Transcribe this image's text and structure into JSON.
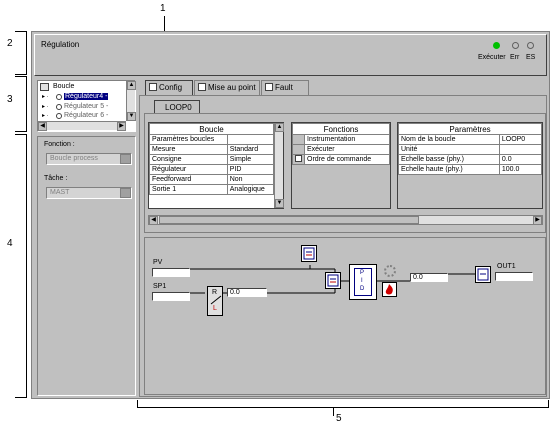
{
  "callouts": [
    "1",
    "2",
    "3",
    "4",
    "5"
  ],
  "header": {
    "title": "Régulation",
    "status": {
      "execute_label": "Exécuter",
      "err_label": "Err",
      "es_label": "ES",
      "execute_color": "#00c000"
    }
  },
  "tree": {
    "root": "Boucle",
    "items": [
      "Régulateur4 -",
      "Régulateur 5 -",
      "Régulateur 6 -"
    ]
  },
  "side": {
    "function_label": "Fonction :",
    "function_value": "Boucle process",
    "task_label": "Tâche :",
    "task_value": "MAST"
  },
  "tabs": [
    "Config",
    "Mise au point",
    "Fault"
  ],
  "loop_tab": "LOOP0",
  "boucle_table": {
    "header": "Boucle",
    "rows": [
      [
        "Paramètres boucles",
        ""
      ],
      [
        "Mesure",
        "Standard"
      ],
      [
        "Consigne",
        "Simple"
      ],
      [
        "Régulateur",
        "PID"
      ],
      [
        "Feedforward",
        "Non"
      ],
      [
        "Sortie 1",
        "Analogique"
      ]
    ]
  },
  "fonctions_table": {
    "header": "Fonctions",
    "rows": [
      "Instrumentation",
      "Exécuter",
      "Ordre de commande"
    ]
  },
  "params_table": {
    "header": "Paramètres",
    "rows": [
      [
        "Nom de la boucle",
        "LOOP0"
      ],
      [
        "Unité",
        ""
      ],
      [
        "Echelle basse (phy.)",
        "0.0"
      ],
      [
        "Echelle haute (phy.)",
        "100.0"
      ]
    ]
  },
  "diagram": {
    "pv_label": "PV",
    "sp1_label": "SP1",
    "out1_label": "OUT1",
    "sp_value": "0.0",
    "out_value": "0.0",
    "pid_letters": [
      "P",
      "I",
      "D"
    ],
    "rl_letters": [
      "R",
      "L"
    ]
  }
}
